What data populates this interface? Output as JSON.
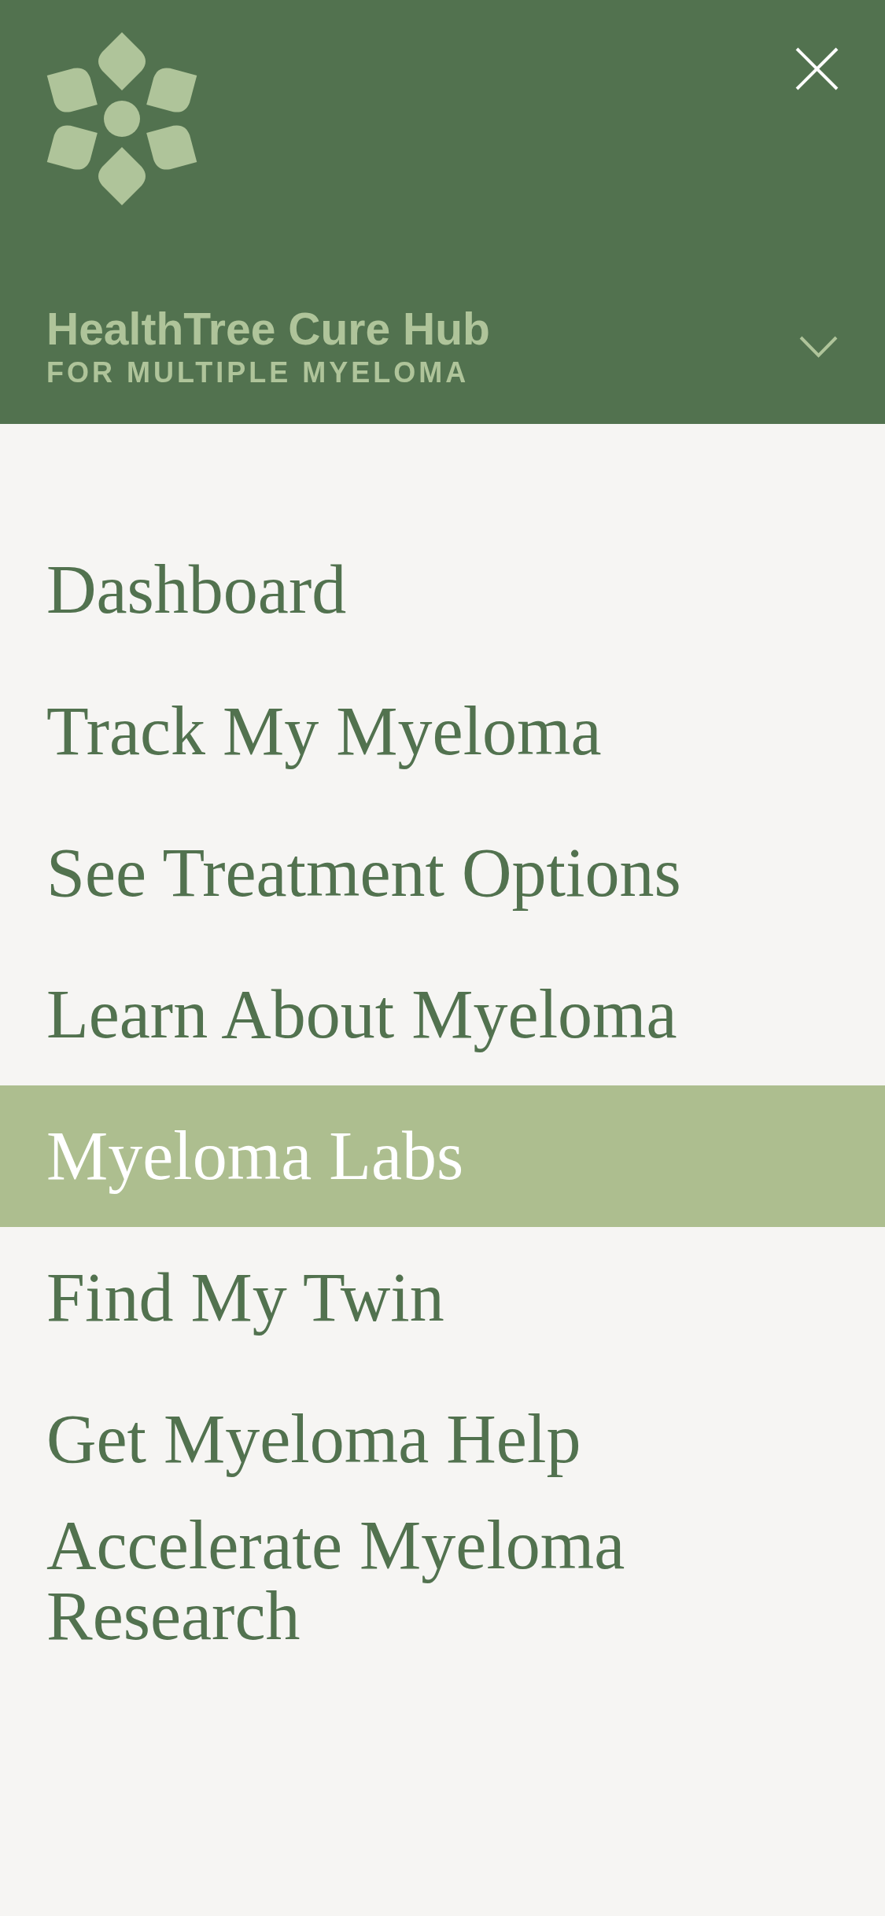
{
  "header": {
    "title": "HealthTree Cure Hub",
    "subtitle": "FOR MULTIPLE MYELOMA"
  },
  "menu": {
    "items": [
      {
        "label": "Dashboard",
        "selected": false
      },
      {
        "label": "Track My Myeloma",
        "selected": false
      },
      {
        "label": "See Treatment Options",
        "selected": false
      },
      {
        "label": "Learn About Myeloma",
        "selected": false
      },
      {
        "label": "Myeloma Labs",
        "selected": true
      },
      {
        "label": "Find My Twin",
        "selected": false
      },
      {
        "label": "Get Myeloma Help",
        "selected": false
      },
      {
        "label": "Accelerate Myeloma Research",
        "selected": false
      }
    ]
  }
}
